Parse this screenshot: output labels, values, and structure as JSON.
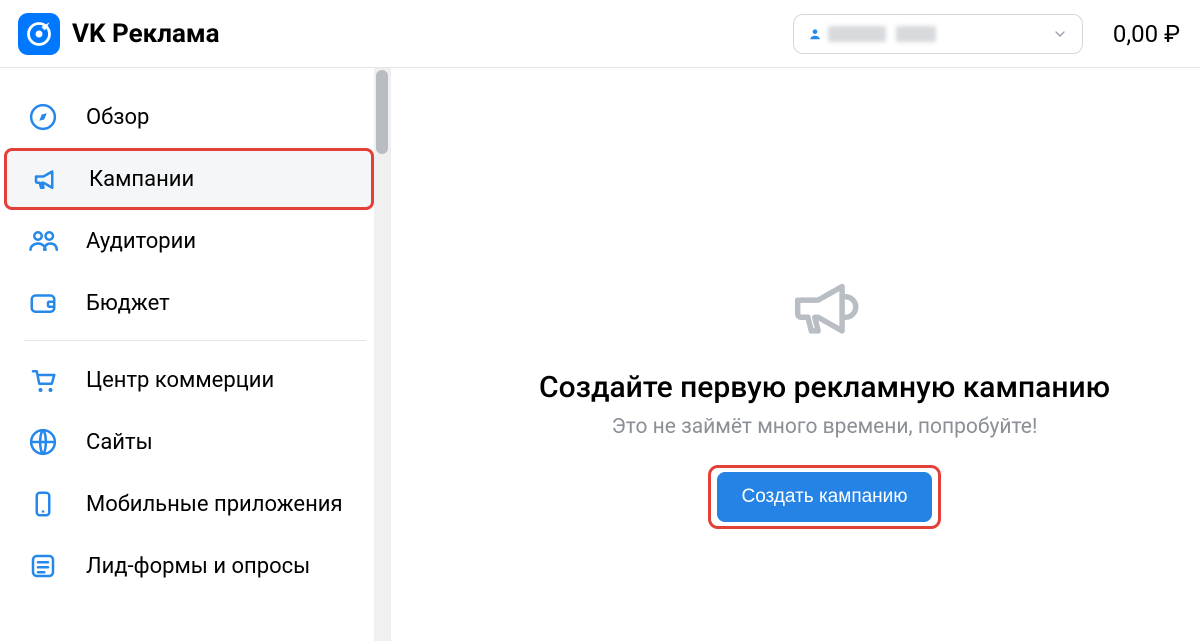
{
  "header": {
    "app_title": "VK Реклама",
    "balance": "0,00 ₽"
  },
  "sidebar": {
    "items": [
      {
        "label": "Обзор"
      },
      {
        "label": "Кампании"
      },
      {
        "label": "Аудитории"
      },
      {
        "label": "Бюджет"
      },
      {
        "label": "Центр коммерции"
      },
      {
        "label": "Сайты"
      },
      {
        "label": "Мобильные приложения"
      },
      {
        "label": "Лид-формы и опросы"
      }
    ]
  },
  "main": {
    "empty_title": "Создайте первую рекламную кампанию",
    "empty_subtitle": "Это не займёт много времени, попробуйте!",
    "create_label": "Создать кампанию"
  }
}
